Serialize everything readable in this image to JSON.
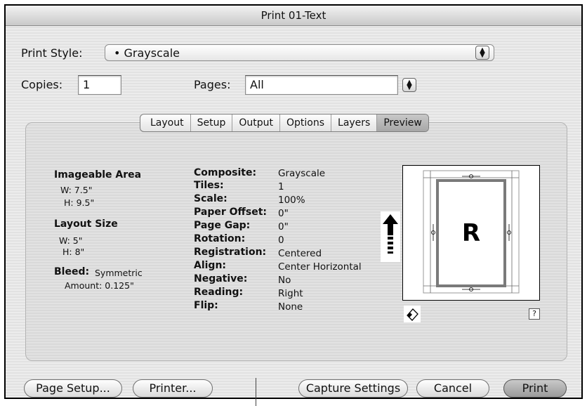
{
  "window": {
    "title": "Print 01-Text"
  },
  "print_style": {
    "label": "Print Style:",
    "value": "• Grayscale"
  },
  "copies": {
    "label": "Copies:",
    "value": "1"
  },
  "pages": {
    "label": "Pages:",
    "value": "All"
  },
  "tabs": [
    "Layout",
    "Setup",
    "Output",
    "Options",
    "Layers",
    "Preview"
  ],
  "active_tab": "Preview",
  "left_info": {
    "imageable_area_title": "Imageable Area",
    "ia_w": "W: 7.5\"",
    "ia_h": "H: 9.5\"",
    "layout_size_title": "Layout Size",
    "ls_w": "W: 5\"",
    "ls_h": "H: 8\"",
    "bleed_label": "Bleed:",
    "bleed_value": "Symmetric",
    "amount": "Amount: 0.125\""
  },
  "settings": [
    {
      "label": "Composite:",
      "value": "Grayscale"
    },
    {
      "label": "Tiles:",
      "value": "1"
    },
    {
      "label": "Scale:",
      "value": "100%"
    },
    {
      "label": "Paper Offset:",
      "value": "0\""
    },
    {
      "label": "Page Gap:",
      "value": "0\""
    },
    {
      "label": "Rotation:",
      "value": "0"
    },
    {
      "label": "Registration:",
      "value": "Centered"
    },
    {
      "label": "Align:",
      "value": "Center Horizontal"
    },
    {
      "label": "Negative:",
      "value": "No"
    },
    {
      "label": "Reading:",
      "value": "Right"
    },
    {
      "label": "Flip:",
      "value": "None"
    }
  ],
  "preview": {
    "page_letter": "R",
    "help": "?"
  },
  "buttons": {
    "page_setup": "Page Setup...",
    "printer": "Printer...",
    "capture_settings": "Capture Settings",
    "cancel": "Cancel",
    "print": "Print"
  },
  "icons": {
    "feed_arrow": "up-arrow-icon",
    "orientation": "orientation-icon",
    "stepper": "stepper-icon"
  }
}
